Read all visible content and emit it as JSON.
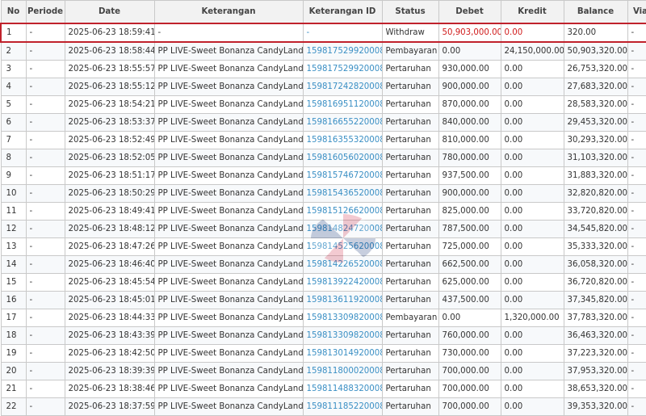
{
  "columns": {
    "no": "No",
    "periode": "Periode",
    "date": "Date",
    "keterangan": "Keterangan",
    "keterangan_id": "Keterangan ID",
    "status": "Status",
    "debet": "Debet",
    "kredit": "Kredit",
    "balance": "Balance",
    "via": "Via"
  },
  "rows": [
    {
      "no": "1",
      "periode": "-",
      "date": "2025-06-23 18:59:41",
      "keterangan": "-",
      "keterangan_id": "-",
      "status": "Withdraw",
      "debet": "50,903,000.00",
      "kredit": "0.00",
      "balance": "320.00",
      "via": "-"
    },
    {
      "no": "2",
      "periode": "-",
      "date": "2025-06-23 18:58:44",
      "keterangan": "PP LIVE-Sweet Bonanza CandyLand",
      "keterangan_id": "159817529920008",
      "status": "Pembayaran",
      "debet": "0.00",
      "kredit": "24,150,000.00",
      "balance": "50,903,320.00",
      "via": "-"
    },
    {
      "no": "3",
      "periode": "-",
      "date": "2025-06-23 18:55:57",
      "keterangan": "PP LIVE-Sweet Bonanza CandyLand",
      "keterangan_id": "159817529920008",
      "status": "Pertaruhan",
      "debet": "930,000.00",
      "kredit": "0.00",
      "balance": "26,753,320.00",
      "via": "-"
    },
    {
      "no": "4",
      "periode": "-",
      "date": "2025-06-23 18:55:12",
      "keterangan": "PP LIVE-Sweet Bonanza CandyLand",
      "keterangan_id": "159817242820008",
      "status": "Pertaruhan",
      "debet": "900,000.00",
      "kredit": "0.00",
      "balance": "27,683,320.00",
      "via": "-"
    },
    {
      "no": "5",
      "periode": "-",
      "date": "2025-06-23 18:54:21",
      "keterangan": "PP LIVE-Sweet Bonanza CandyLand",
      "keterangan_id": "159816951120008",
      "status": "Pertaruhan",
      "debet": "870,000.00",
      "kredit": "0.00",
      "balance": "28,583,320.00",
      "via": "-"
    },
    {
      "no": "6",
      "periode": "-",
      "date": "2025-06-23 18:53:37",
      "keterangan": "PP LIVE-Sweet Bonanza CandyLand",
      "keterangan_id": "159816655220008",
      "status": "Pertaruhan",
      "debet": "840,000.00",
      "kredit": "0.00",
      "balance": "29,453,320.00",
      "via": "-"
    },
    {
      "no": "7",
      "periode": "-",
      "date": "2025-06-23 18:52:49",
      "keterangan": "PP LIVE-Sweet Bonanza CandyLand",
      "keterangan_id": "159816355320008",
      "status": "Pertaruhan",
      "debet": "810,000.00",
      "kredit": "0.00",
      "balance": "30,293,320.00",
      "via": "-"
    },
    {
      "no": "8",
      "periode": "-",
      "date": "2025-06-23 18:52:05",
      "keterangan": "PP LIVE-Sweet Bonanza CandyLand",
      "keterangan_id": "159816056020008",
      "status": "Pertaruhan",
      "debet": "780,000.00",
      "kredit": "0.00",
      "balance": "31,103,320.00",
      "via": "-"
    },
    {
      "no": "9",
      "periode": "-",
      "date": "2025-06-23 18:51:17",
      "keterangan": "PP LIVE-Sweet Bonanza CandyLand",
      "keterangan_id": "159815746720008",
      "status": "Pertaruhan",
      "debet": "937,500.00",
      "kredit": "0.00",
      "balance": "31,883,320.00",
      "via": "-"
    },
    {
      "no": "10",
      "periode": "-",
      "date": "2025-06-23 18:50:29",
      "keterangan": "PP LIVE-Sweet Bonanza CandyLand",
      "keterangan_id": "159815436520008",
      "status": "Pertaruhan",
      "debet": "900,000.00",
      "kredit": "0.00",
      "balance": "32,820,820.00",
      "via": "-"
    },
    {
      "no": "11",
      "periode": "-",
      "date": "2025-06-23 18:49:41",
      "keterangan": "PP LIVE-Sweet Bonanza CandyLand",
      "keterangan_id": "159815126620008",
      "status": "Pertaruhan",
      "debet": "825,000.00",
      "kredit": "0.00",
      "balance": "33,720,820.00",
      "via": "-"
    },
    {
      "no": "12",
      "periode": "-",
      "date": "2025-06-23 18:48:12",
      "keterangan": "PP LIVE-Sweet Bonanza CandyLand",
      "keterangan_id": "159814824720008",
      "status": "Pertaruhan",
      "debet": "787,500.00",
      "kredit": "0.00",
      "balance": "34,545,820.00",
      "via": "-"
    },
    {
      "no": "13",
      "periode": "-",
      "date": "2025-06-23 18:47:26",
      "keterangan": "PP LIVE-Sweet Bonanza CandyLand",
      "keterangan_id": "159814525620008",
      "status": "Pertaruhan",
      "debet": "725,000.00",
      "kredit": "0.00",
      "balance": "35,333,320.00",
      "via": "-"
    },
    {
      "no": "14",
      "periode": "-",
      "date": "2025-06-23 18:46:40",
      "keterangan": "PP LIVE-Sweet Bonanza CandyLand",
      "keterangan_id": "159814226520008",
      "status": "Pertaruhan",
      "debet": "662,500.00",
      "kredit": "0.00",
      "balance": "36,058,320.00",
      "via": "-"
    },
    {
      "no": "15",
      "periode": "-",
      "date": "2025-06-23 18:45:54",
      "keterangan": "PP LIVE-Sweet Bonanza CandyLand",
      "keterangan_id": "159813922420008",
      "status": "Pertaruhan",
      "debet": "625,000.00",
      "kredit": "0.00",
      "balance": "36,720,820.00",
      "via": "-"
    },
    {
      "no": "16",
      "periode": "-",
      "date": "2025-06-23 18:45:01",
      "keterangan": "PP LIVE-Sweet Bonanza CandyLand",
      "keterangan_id": "159813611920008",
      "status": "Pertaruhan",
      "debet": "437,500.00",
      "kredit": "0.00",
      "balance": "37,345,820.00",
      "via": "-"
    },
    {
      "no": "17",
      "periode": "-",
      "date": "2025-06-23 18:44:33",
      "keterangan": "PP LIVE-Sweet Bonanza CandyLand",
      "keterangan_id": "159813309820008",
      "status": "Pembayaran",
      "debet": "0.00",
      "kredit": "1,320,000.00",
      "balance": "37,783,320.00",
      "via": "-"
    },
    {
      "no": "18",
      "periode": "-",
      "date": "2025-06-23 18:43:39",
      "keterangan": "PP LIVE-Sweet Bonanza CandyLand",
      "keterangan_id": "159813309820008",
      "status": "Pertaruhan",
      "debet": "760,000.00",
      "kredit": "0.00",
      "balance": "36,463,320.00",
      "via": "-"
    },
    {
      "no": "19",
      "periode": "-",
      "date": "2025-06-23 18:42:50",
      "keterangan": "PP LIVE-Sweet Bonanza CandyLand",
      "keterangan_id": "159813014920008",
      "status": "Pertaruhan",
      "debet": "730,000.00",
      "kredit": "0.00",
      "balance": "37,223,320.00",
      "via": "-"
    },
    {
      "no": "20",
      "periode": "-",
      "date": "2025-06-23 18:39:39",
      "keterangan": "PP LIVE-Sweet Bonanza CandyLand",
      "keterangan_id": "159811800020008",
      "status": "Pertaruhan",
      "debet": "700,000.00",
      "kredit": "0.00",
      "balance": "37,953,320.00",
      "via": "-"
    },
    {
      "no": "21",
      "periode": "-",
      "date": "2025-06-23 18:38:46",
      "keterangan": "PP LIVE-Sweet Bonanza CandyLand",
      "keterangan_id": "159811488320008",
      "status": "Pertaruhan",
      "debet": "700,000.00",
      "kredit": "0.00",
      "balance": "38,653,320.00",
      "via": "-"
    },
    {
      "no": "22",
      "periode": "-",
      "date": "2025-06-23 18:37:59",
      "keterangan": "PP LIVE-Sweet Bonanza CandyLand",
      "keterangan_id": "159811185220008",
      "status": "Pertaruhan",
      "debet": "700,000.00",
      "kredit": "0.00",
      "balance": "39,353,320.00",
      "via": "-"
    }
  ],
  "highlighted_row": "1",
  "colors": {
    "highlight_border": "#c0222c",
    "highlight_amount": "#d01a1a",
    "link_text": "#3a8fc4",
    "watermark": "#2aa6d8"
  }
}
